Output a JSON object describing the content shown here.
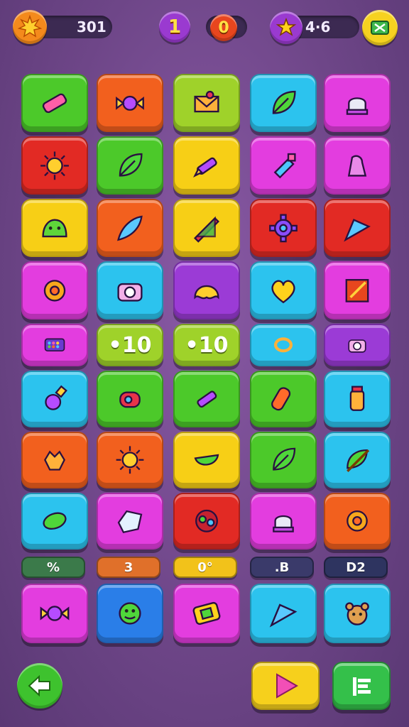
{
  "hud": {
    "coins": "301",
    "level_badge": "1",
    "counter": "0",
    "stars": "4·6"
  },
  "colors": {
    "green": "#4cc92a",
    "orange": "#f2601e",
    "lime": "#9fd22a",
    "cyan": "#2cc3ee",
    "magenta": "#e33ddf",
    "yellow": "#f7cf16",
    "red": "#e22a24",
    "purple": "#9b3bd6",
    "blue": "#2a7ee8"
  },
  "board": {
    "rows": [
      [
        {
          "color": "green",
          "icon": "eraser-icon"
        },
        {
          "color": "orange",
          "icon": "candy-icon"
        },
        {
          "color": "lime",
          "icon": "envelope-icon"
        },
        {
          "color": "cyan",
          "icon": "leaf-icon"
        },
        {
          "color": "magenta",
          "icon": "bell-icon"
        }
      ],
      [
        {
          "color": "red",
          "icon": "sun-icon"
        },
        {
          "color": "green",
          "icon": "leaf-icon"
        },
        {
          "color": "yellow",
          "icon": "pencil-icon"
        },
        {
          "color": "magenta",
          "icon": "bottle-icon"
        },
        {
          "color": "magenta",
          "icon": "hat-icon"
        }
      ],
      [
        {
          "color": "yellow",
          "icon": "slime-icon"
        },
        {
          "color": "orange",
          "icon": "feather-icon"
        },
        {
          "color": "yellow",
          "icon": "ruler-icon"
        },
        {
          "color": "red",
          "icon": "gear-icon"
        },
        {
          "color": "red",
          "icon": "cone-icon"
        }
      ],
      [
        {
          "color": "magenta",
          "icon": "flower-icon"
        },
        {
          "color": "cyan",
          "icon": "camera-icon"
        },
        {
          "color": "purple",
          "icon": "blob-icon"
        },
        {
          "color": "cyan",
          "icon": "heart-icon"
        },
        {
          "color": "magenta",
          "icon": "frame-icon"
        }
      ]
    ],
    "bonus_row": [
      {
        "color": "magenta",
        "icon": "palette-icon",
        "label": ""
      },
      {
        "color": "lime",
        "icon": "",
        "label": "•10"
      },
      {
        "color": "lime",
        "icon": "",
        "label": "•10"
      },
      {
        "color": "cyan",
        "icon": "ring-icon",
        "label": ""
      },
      {
        "color": "purple",
        "icon": "camera-icon",
        "label": ""
      }
    ],
    "rows2": [
      [
        {
          "color": "cyan",
          "icon": "potion-icon"
        },
        {
          "color": "green",
          "icon": "can-icon"
        },
        {
          "color": "green",
          "icon": "marker-icon"
        },
        {
          "color": "green",
          "icon": "bandage-icon"
        },
        {
          "color": "cyan",
          "icon": "jar-icon"
        }
      ],
      [
        {
          "color": "orange",
          "icon": "fruit-icon"
        },
        {
          "color": "orange",
          "icon": "sun-icon"
        },
        {
          "color": "yellow",
          "icon": "boat-icon"
        },
        {
          "color": "green",
          "icon": "leaf-icon"
        },
        {
          "color": "cyan",
          "icon": "sword-leaf-icon"
        }
      ],
      [
        {
          "color": "cyan",
          "icon": "cucumber-icon"
        },
        {
          "color": "magenta",
          "icon": "crystal-icon"
        },
        {
          "color": "red",
          "icon": "ball-icon"
        },
        {
          "color": "magenta",
          "icon": "bell-icon"
        },
        {
          "color": "orange",
          "icon": "flower-icon"
        }
      ]
    ],
    "labels": [
      {
        "color": "#3b7a4a",
        "text": "%"
      },
      {
        "color": "#e0702a",
        "text": "3"
      },
      {
        "color": "#f2c21a",
        "text": "0°"
      },
      {
        "color": "#3a3a6a",
        "text": ".B"
      },
      {
        "color": "#2e3460",
        "text": "D2"
      }
    ],
    "last_row": [
      {
        "color": "magenta",
        "icon": "candy-icon"
      },
      {
        "color": "blue",
        "icon": "monster-icon"
      },
      {
        "color": "magenta",
        "icon": "ticket-icon"
      },
      {
        "color": "cyan",
        "icon": "cone-icon"
      },
      {
        "color": "cyan",
        "icon": "bear-icon"
      }
    ]
  },
  "controls": {
    "back": "back-arrow-icon",
    "play": "play-icon",
    "menu": "menu-icon"
  }
}
